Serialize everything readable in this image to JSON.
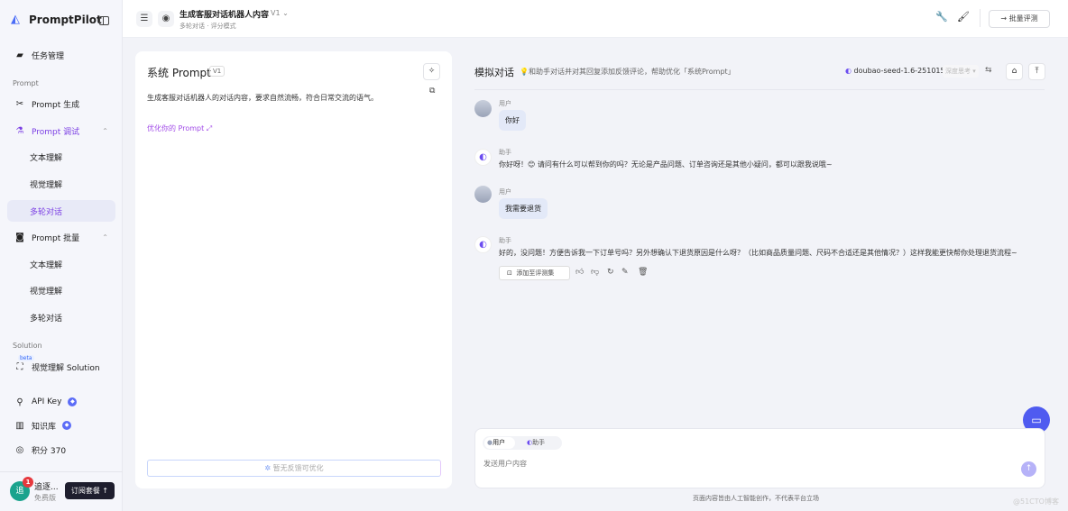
{
  "sidebar": {
    "brand": "PromptPilot",
    "task_management": "任务管理",
    "section_prompt": "Prompt",
    "prompt_generate": "Prompt 生成",
    "prompt_debug": "Prompt 调试",
    "debug_items": [
      "文本理解",
      "视觉理解",
      "多轮对话"
    ],
    "prompt_batch": "Prompt 批量",
    "batch_items": [
      "文本理解",
      "视觉理解",
      "多轮对话"
    ],
    "section_solution": "Solution",
    "beta": "beta",
    "visual_solution": "视觉理解 Solution",
    "api_key": "API Key",
    "knowledge_base": "知识库",
    "points": "积分 370",
    "user_initial": "追",
    "user_name": "追逐...",
    "notification_count": "1",
    "plan": "免费版",
    "subscribe": "订阅套餐 ↑"
  },
  "header": {
    "title": "生成客服对话机器人内容",
    "version": "V1",
    "subtitle": "多轮对话 · 评分模式",
    "batch_eval": "批量评测"
  },
  "system_prompt": {
    "title": "系统 Prompt",
    "version": "V1",
    "content": "生成客服对话机器人的对话内容，要求自然流畅，符合日常交流的语气。",
    "optimize_link": "优化你的 Prompt",
    "no_feedback": "暂无反馈可优化"
  },
  "chat": {
    "title": "模拟对话",
    "hint": "和助手对话并对其回复添加反馈评论，帮助优化「系统Prompt」",
    "model": "doubao-seed-1.6-251015",
    "deep_think": "深度思考",
    "messages": [
      {
        "role": "用户",
        "text": "你好"
      },
      {
        "role": "助手",
        "text": "你好呀！😊 请问有什么可以帮到你的吗？无论是产品问题、订单咨询还是其他小疑问，都可以跟我说哦~"
      },
      {
        "role": "用户",
        "text": "我需要退货"
      },
      {
        "role": "助手",
        "text": "好的，没问题！方便告诉我一下订单号吗？另外想确认下退货原因是什么呀？（比如商品质量问题、尺码不合适还是其他情况？）这样我能更快帮你处理退货流程~"
      }
    ],
    "add_to_eval": "添加至评测集",
    "input_role_user": "用户",
    "input_role_assistant": "助手",
    "input_placeholder": "发送用户内容",
    "disclaimer": "页面内容皆由人工智能创作，不代表平台立场"
  },
  "watermark": "@51CTO博客",
  "colors": {
    "accent": "#7b3fe4",
    "primary": "#4f5bf0"
  }
}
